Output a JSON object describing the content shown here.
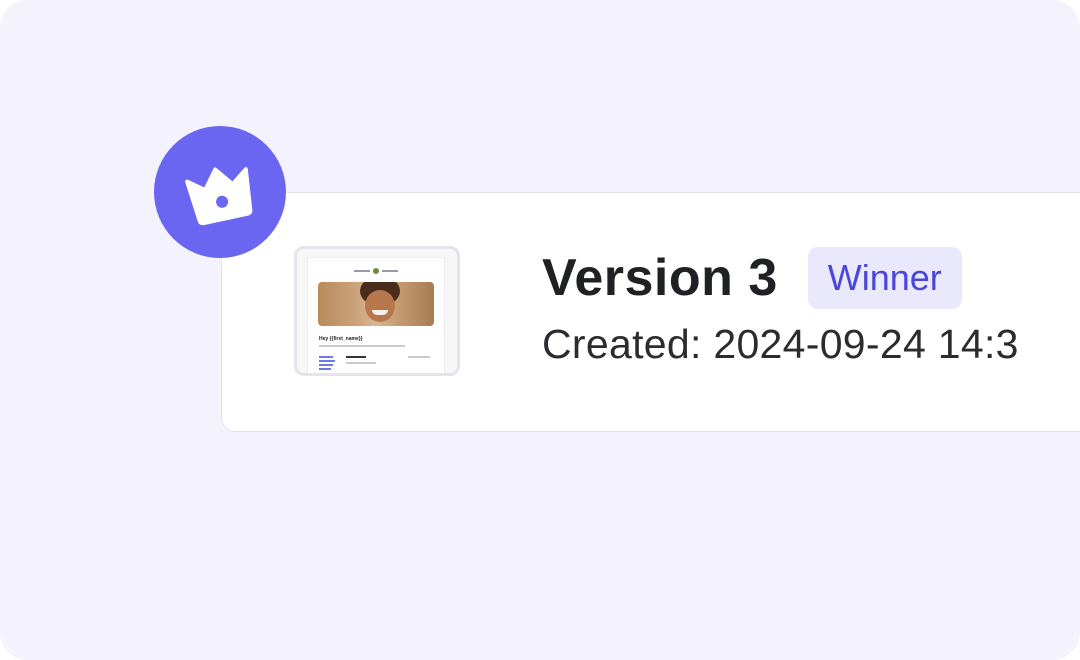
{
  "version_card": {
    "title": "Version 3",
    "badge": "Winner",
    "created": "Created: 2024-09-24 14:3",
    "thumbnail": {
      "greeting": "Hey {{first_name}}",
      "image_subject": "smiling child portrait"
    }
  },
  "icons": {
    "crown": "crown-icon"
  },
  "colors": {
    "background": "#f3f2fd",
    "accent": "#6a66f2",
    "badge_bg": "#e9e8fc",
    "badge_text": "#4a46d8",
    "title_text": "#202124"
  }
}
